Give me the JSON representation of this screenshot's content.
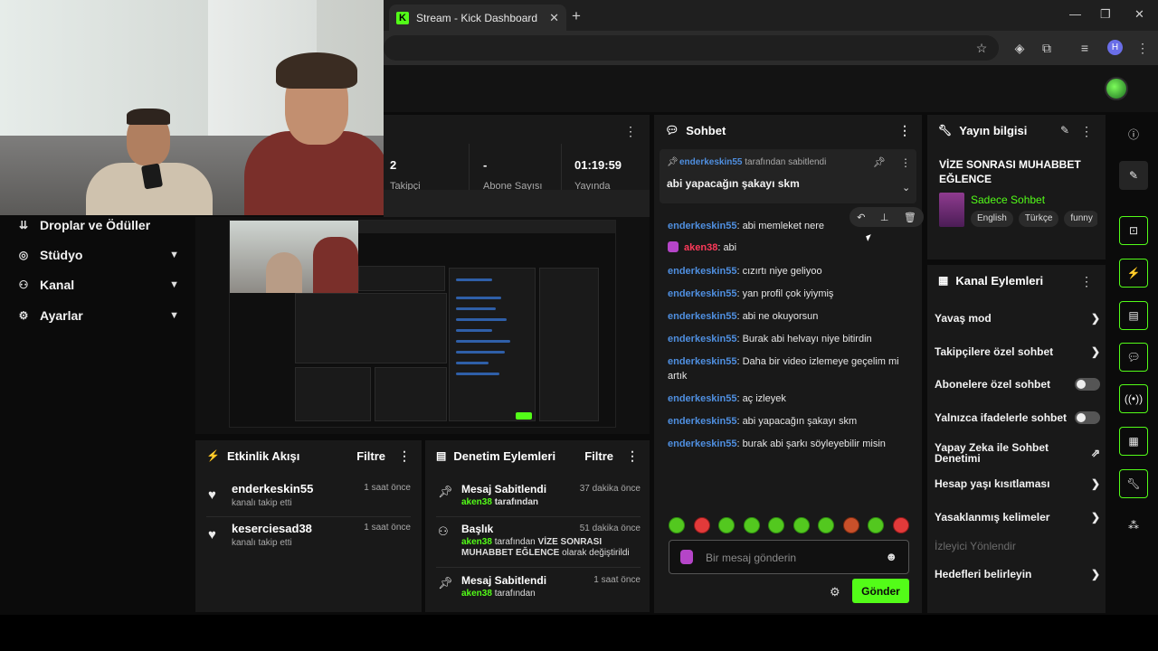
{
  "browser": {
    "tab_title": "Stream - Kick Dashboard",
    "tab_favicon": "K",
    "new_tab": "+",
    "profile_initial": "H"
  },
  "colors": {
    "accent": "#53fc18",
    "username_blue": "#4f8fe0",
    "username_red": "#ff3a5a",
    "panel_bg": "#191919"
  },
  "sidebar": {
    "items": [
      {
        "label": "Droplar ve Ödüller",
        "icon": "drops-icon",
        "has_chevron": false
      },
      {
        "label": "Stüdyo",
        "icon": "studio-icon",
        "has_chevron": true
      },
      {
        "label": "Kanal",
        "icon": "channel-icon",
        "has_chevron": true
      },
      {
        "label": "Ayarlar",
        "icon": "settings-icon",
        "has_chevron": true
      }
    ]
  },
  "stats": {
    "values": [
      "2",
      "-",
      "01:19:59"
    ],
    "labels": [
      "Takipçi",
      "Abone Sayısı",
      "Yayında"
    ]
  },
  "activity": {
    "title": "Etkinlik Akışı",
    "filter_label": "Filtre",
    "events": [
      {
        "user": "enderkeskin55",
        "text": "kanalı takip etti",
        "time": "1 saat önce"
      },
      {
        "user": "keserciesad38",
        "text": "kanalı takip etti",
        "time": "1 saat önce"
      }
    ]
  },
  "moderation": {
    "title": "Denetim Eylemleri",
    "filter_label": "Filtre",
    "entries": [
      {
        "title": "Mesaj Sabitlendi",
        "time": "37 dakika önce",
        "user": "aken38",
        "text": "tarafından"
      },
      {
        "title": "Başlık",
        "time": "51 dakika önce",
        "user": "aken38",
        "text": "tarafından",
        "highlight": "VİZE SONRASI MUHABBET EĞLENCE",
        "suffix": "olarak değiştirildi"
      },
      {
        "title": "Mesaj Sabitlendi",
        "time": "1 saat önce",
        "user": "aken38",
        "text": "tarafından"
      }
    ]
  },
  "chat": {
    "title": "Sohbet",
    "pinned": {
      "by_user": "enderkeskin55",
      "by_text": "tarafından sabitlendi",
      "message": "abi yapacağın şakayı skm"
    },
    "messages": [
      {
        "user": "enderkeskin55",
        "text": "abi memleket nere",
        "color": "blue",
        "mic": false
      },
      {
        "user": "aken38",
        "text": "abi",
        "color": "red",
        "mic": true
      },
      {
        "user": "enderkeskin55",
        "text": "cızırtı niye geliyoo",
        "color": "blue",
        "mic": false
      },
      {
        "user": "enderkeskin55",
        "text": "yan profil çok iyiymiş",
        "color": "blue",
        "mic": false
      },
      {
        "user": "enderkeskin55",
        "text": "abi ne okuyorsun",
        "color": "blue",
        "mic": false
      },
      {
        "user": "enderkeskin55",
        "text": "Burak abi helvayı niye bitirdin",
        "color": "blue",
        "mic": false
      },
      {
        "user": "enderkeskin55",
        "text": "Daha bir video izlemeye geçelim mi artık",
        "color": "blue",
        "mic": false
      },
      {
        "user": "enderkeskin55",
        "text": "aç izleyek",
        "color": "blue",
        "mic": false
      },
      {
        "user": "enderkeskin55",
        "text": "abi yapacağın şakayı skm",
        "color": "blue",
        "mic": false
      },
      {
        "user": "enderkeskin55",
        "text": "burak abi şarkı söyleyebilir misin",
        "color": "blue",
        "mic": false
      }
    ],
    "input_placeholder": "Bir mesaj gönderin",
    "send_label": "Gönder"
  },
  "stream_info": {
    "title": "Yayın bilgisi",
    "stream_title": "VİZE SONRASI MUHABBET EĞLENCE",
    "category": "Sadece Sohbet",
    "tags": [
      "English",
      "Türkçe",
      "funny"
    ]
  },
  "channel_actions": {
    "title": "Kanal Eylemleri",
    "items": [
      {
        "label": "Yavaş mod",
        "kind": "arrow"
      },
      {
        "label": "Takipçilere özel sohbet",
        "kind": "arrow"
      },
      {
        "label": "Abonelere özel sohbet",
        "kind": "toggle",
        "on": false
      },
      {
        "label": "Yalnızca ifadelerle sohbet",
        "kind": "toggle",
        "on": false
      },
      {
        "label": "Yapay Zeka ile Sohbet Denetimi",
        "kind": "external"
      },
      {
        "label": "Hesap yaşı kısıtlaması",
        "kind": "arrow"
      },
      {
        "label": "Yasaklanmış kelimeler",
        "kind": "arrow"
      },
      {
        "label": "İzleyici Yönlendir",
        "kind": "disabled"
      },
      {
        "label": "Hedefleri belirleyin",
        "kind": "arrow"
      }
    ]
  }
}
